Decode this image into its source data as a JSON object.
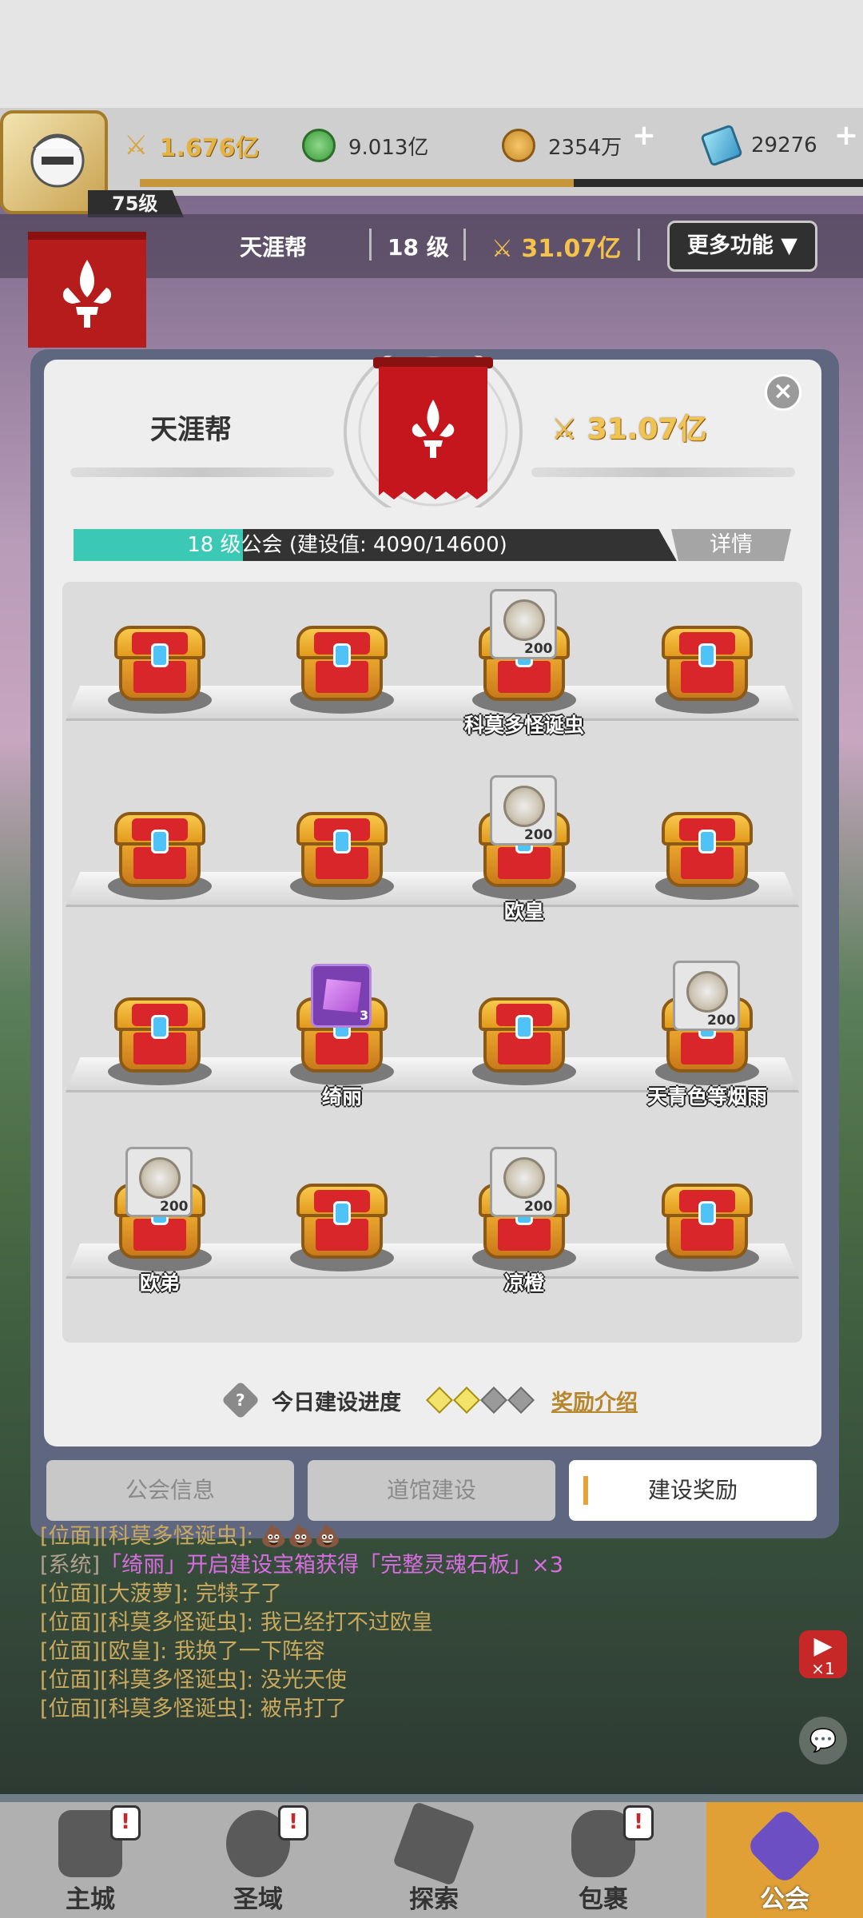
{
  "player": {
    "level": "75级"
  },
  "resources": {
    "power": "1.676亿",
    "green_gems": "9.013亿",
    "gold": "2354万",
    "crystals": "29276",
    "exp_progress": 0.6
  },
  "guild_header": {
    "name": "天涯帮",
    "level": "18 级",
    "power": "31.07亿",
    "more_label": "更多功能 ▼"
  },
  "dialog": {
    "title": "天涯帮",
    "power": "31.07亿",
    "progress_label": "18 级公会 (建设值:  4090/14600)",
    "progress_value": 4090,
    "progress_max": 14600,
    "detail_label": "详情",
    "close_label": "×",
    "chests": [
      {
        "owner": "",
        "reward": "none"
      },
      {
        "owner": "",
        "reward": "none"
      },
      {
        "owner": "科莫多怪诞虫",
        "reward": "coin",
        "count": "200"
      },
      {
        "owner": "",
        "reward": "none"
      },
      {
        "owner": "",
        "reward": "none"
      },
      {
        "owner": "",
        "reward": "none"
      },
      {
        "owner": "欧皇",
        "reward": "coin",
        "count": "200"
      },
      {
        "owner": "",
        "reward": "none"
      },
      {
        "owner": "",
        "reward": "none"
      },
      {
        "owner": "绮丽",
        "reward": "soul-stone",
        "count": "3"
      },
      {
        "owner": "",
        "reward": "none"
      },
      {
        "owner": "天青色等烟雨",
        "reward": "coin",
        "count": "200"
      },
      {
        "owner": "欧弟",
        "reward": "coin",
        "count": "200"
      },
      {
        "owner": "",
        "reward": "none"
      },
      {
        "owner": "凉橙",
        "reward": "coin",
        "count": "200"
      },
      {
        "owner": "",
        "reward": "none"
      }
    ],
    "daily_label": "今日建设进度",
    "daily_help": "?",
    "daily_filled": 2,
    "daily_total": 4,
    "reward_link": "奖励介绍",
    "tabs": [
      {
        "label": "公会信息",
        "active": false
      },
      {
        "label": "道馆建设",
        "active": false
      },
      {
        "label": "建设奖励",
        "active": true
      }
    ]
  },
  "chat": [
    {
      "prefix": "[位面][科莫多怪诞虫]: ",
      "text": "💩💩💩"
    },
    {
      "prefix": "[系统]",
      "text": "「绮丽」开启建设宝箱获得「完整灵魂石板」×3"
    },
    {
      "prefix": "[位面][大菠萝]: ",
      "text": "完犊子了"
    },
    {
      "prefix": "[位面][科莫多怪诞虫]: ",
      "text": "我已经打不过欧皇"
    },
    {
      "prefix": "[位面][欧皇]: ",
      "text": "我换了一下阵容"
    },
    {
      "prefix": "[位面][科莫多怪诞虫]: ",
      "text": "没光天使"
    },
    {
      "prefix": "[位面][科莫多怪诞虫]: ",
      "text": "被吊打了"
    }
  ],
  "side": {
    "video_multiplier": "×1"
  },
  "nav": [
    {
      "label": "主城",
      "badge": "!"
    },
    {
      "label": "圣域",
      "badge": "!"
    },
    {
      "label": "探索",
      "badge": ""
    },
    {
      "label": "包裹",
      "badge": "!"
    },
    {
      "label": "公会",
      "badge": "",
      "active": true
    }
  ],
  "colors": {
    "accent_teal": "#3bc8b5",
    "gold_text": "#f1c350",
    "guild_red": "#b71c1c"
  }
}
